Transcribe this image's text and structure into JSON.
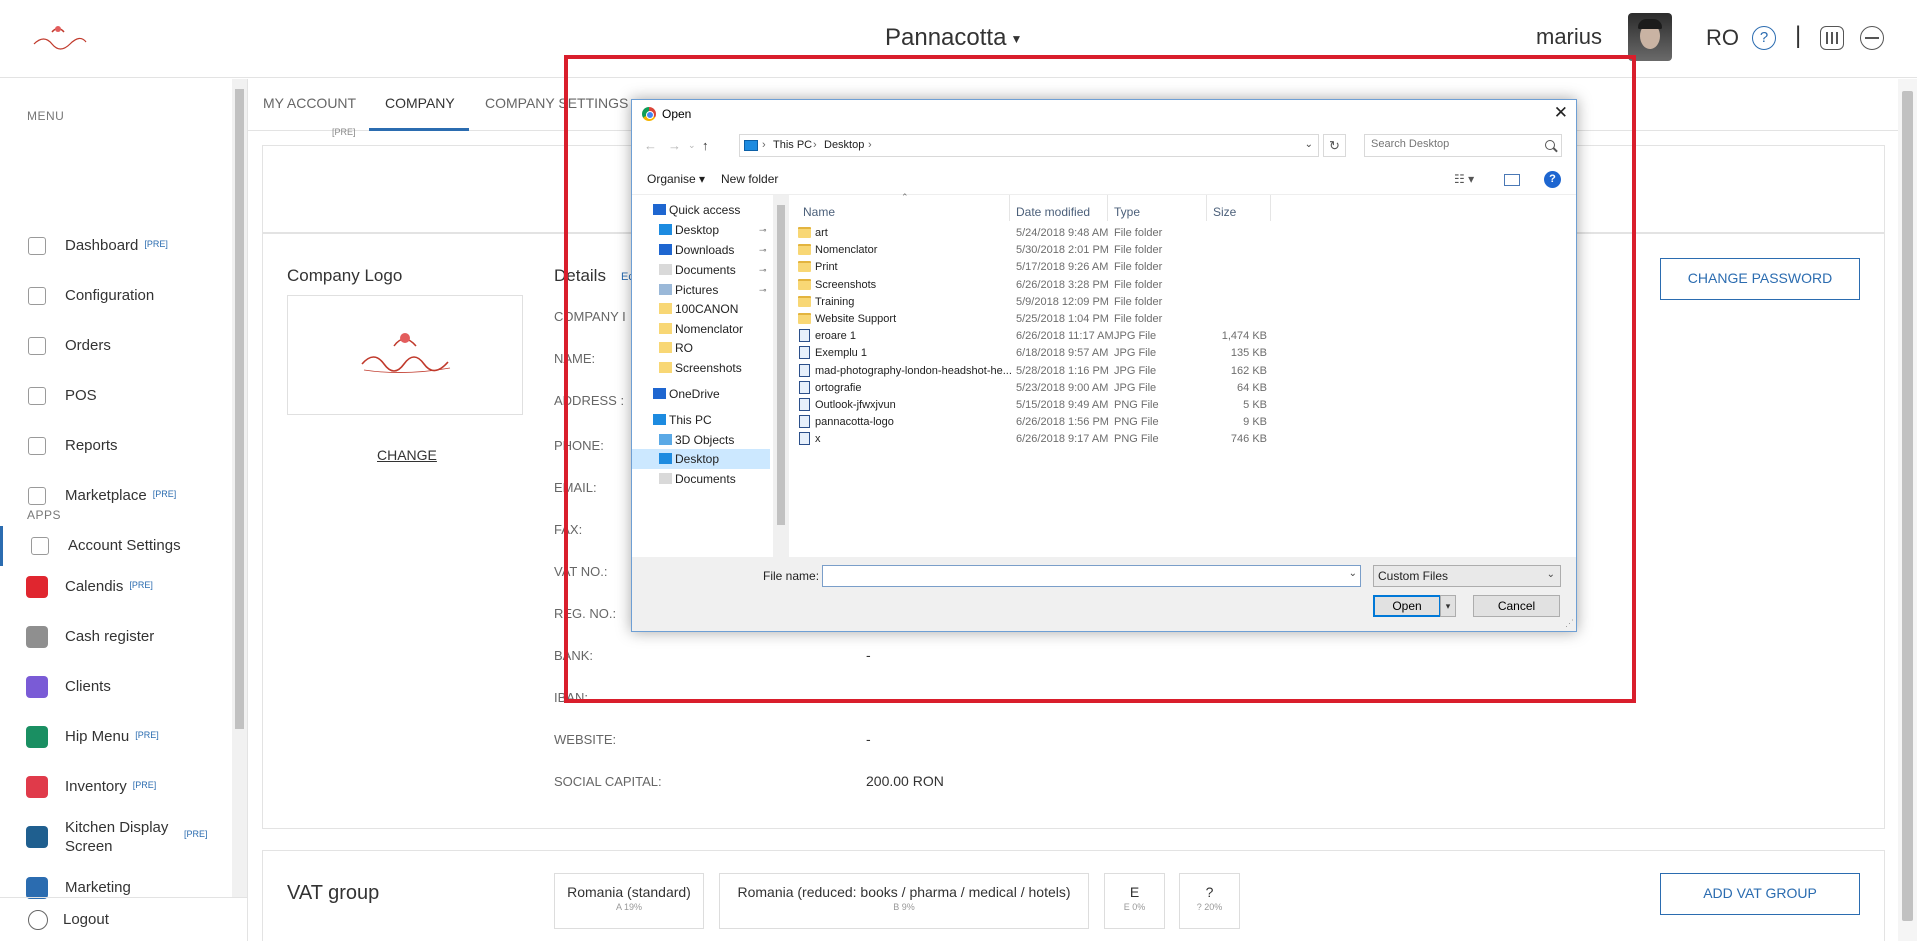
{
  "header": {
    "venue": "Pannacotta",
    "username": "marius",
    "language": "RO",
    "separator": "|"
  },
  "sidebar": {
    "menu_title": "MENU",
    "apps_title": "APPS",
    "pre_tag": "[PRE]",
    "menu_items": [
      {
        "label": "Dashboard",
        "icon": "bar-chart-icon",
        "pre": true
      },
      {
        "label": "Configuration",
        "icon": "tag-icon",
        "pre": false
      },
      {
        "label": "Orders",
        "icon": "lock-icon",
        "pre": false
      },
      {
        "label": "POS",
        "icon": "monitor-icon",
        "pre": false
      },
      {
        "label": "Reports",
        "icon": "line-chart-icon",
        "pre": false
      },
      {
        "label": "Marketplace",
        "icon": "cart-icon",
        "pre": true
      },
      {
        "label": "Account Settings",
        "icon": "gear-icon",
        "pre": false
      }
    ],
    "app_items": [
      {
        "label": "Calendis",
        "pre": true,
        "color": "#e0262f"
      },
      {
        "label": "Cash register",
        "pre": false,
        "color": "#8f8f8f"
      },
      {
        "label": "Clients",
        "pre": false,
        "color": "#7a5bd6"
      },
      {
        "label": "Hip Menu",
        "pre": true,
        "color": "#1a8f62"
      },
      {
        "label": "Inventory",
        "pre": true,
        "color": "#e03a4a"
      },
      {
        "label": "Kitchen Display Screen",
        "pre": true,
        "color": "#1f5f8f"
      },
      {
        "label": "Marketing",
        "pre": false,
        "color": "#2b6cb0"
      }
    ],
    "logout": "Logout"
  },
  "tabs": {
    "items": [
      "MY ACCOUNT",
      "COMPANY",
      "COMPANY SETTINGS"
    ],
    "active": "COMPANY",
    "pre_tag": "[PRE]"
  },
  "company": {
    "logo_title": "Company Logo",
    "change_link": "CHANGE",
    "details_title": "Details",
    "details_edit": "Ec",
    "change_password": "CHANGE PASSWORD",
    "fields": [
      {
        "label": "COMPANY I",
        "value": ""
      },
      {
        "label": "NAME:",
        "value": ""
      },
      {
        "label": "ADDRESS :",
        "value": ""
      },
      {
        "label": "PHONE:",
        "value": ""
      },
      {
        "label": "EMAIL:",
        "value": ""
      },
      {
        "label": "FAX:",
        "value": ""
      },
      {
        "label": "VAT NO.:",
        "value": ""
      },
      {
        "label": "REG. NO.:",
        "value": ""
      },
      {
        "label": "BANK:",
        "value": "-"
      },
      {
        "label": "IBAN:",
        "value": ""
      },
      {
        "label": "WEBSITE:",
        "value": "-"
      },
      {
        "label": "SOCIAL CAPITAL:",
        "value": "200.00 RON"
      }
    ]
  },
  "vat": {
    "title": "VAT group",
    "add_button": "ADD VAT GROUP",
    "groups": [
      {
        "name": "Romania (standard)",
        "sub": "A 19%"
      },
      {
        "name": "Romania (reduced: books / pharma / medical / hotels)",
        "sub": "B 9%"
      },
      {
        "name": "E",
        "sub": "E 0%"
      },
      {
        "name": "?",
        "sub": "? 20%"
      }
    ]
  },
  "dialog": {
    "title": "Open",
    "close": "✕",
    "breadcrumb": [
      "This PC",
      "Desktop"
    ],
    "search_placeholder": "Search Desktop",
    "toolbar": {
      "organise": "Organise ▾",
      "new_folder": "New folder",
      "help": "?"
    },
    "nav_items": [
      {
        "label": "Quick access",
        "icon": "star-icon",
        "pinned": false,
        "indent": 0
      },
      {
        "label": "Desktop",
        "icon": "desktop-icon",
        "pinned": true,
        "indent": 1
      },
      {
        "label": "Downloads",
        "icon": "download-icon",
        "pinned": true,
        "indent": 1
      },
      {
        "label": "Documents",
        "icon": "document-icon",
        "pinned": true,
        "indent": 1
      },
      {
        "label": "Pictures",
        "icon": "picture-icon",
        "pinned": true,
        "indent": 1
      },
      {
        "label": "100CANON",
        "icon": "folder-icon",
        "pinned": false,
        "indent": 1
      },
      {
        "label": "Nomenclator",
        "icon": "folder-icon",
        "pinned": false,
        "indent": 1
      },
      {
        "label": "RO",
        "icon": "folder-icon",
        "pinned": false,
        "indent": 1
      },
      {
        "label": "Screenshots",
        "icon": "folder-icon",
        "pinned": false,
        "indent": 1
      },
      {
        "label": "OneDrive",
        "icon": "cloud-icon",
        "pinned": false,
        "indent": 0
      },
      {
        "label": "This PC",
        "icon": "pc-icon",
        "pinned": false,
        "indent": 0
      },
      {
        "label": "3D Objects",
        "icon": "cube-icon",
        "pinned": false,
        "indent": 1
      },
      {
        "label": "Desktop",
        "icon": "desktop-icon",
        "pinned": false,
        "indent": 1
      },
      {
        "label": "Documents",
        "icon": "document-icon",
        "pinned": false,
        "indent": 1
      }
    ],
    "nav_selected_index": 12,
    "columns": [
      "Name",
      "Date modified",
      "Type",
      "Size"
    ],
    "files": [
      {
        "name": "art",
        "date": "5/24/2018 9:48 AM",
        "type": "File folder",
        "size": "",
        "kind": "folder"
      },
      {
        "name": "Nomenclator",
        "date": "5/30/2018 2:01 PM",
        "type": "File folder",
        "size": "",
        "kind": "folder"
      },
      {
        "name": "Print",
        "date": "5/17/2018 9:26 AM",
        "type": "File folder",
        "size": "",
        "kind": "folder"
      },
      {
        "name": "Screenshots",
        "date": "6/26/2018 3:28 PM",
        "type": "File folder",
        "size": "",
        "kind": "folder"
      },
      {
        "name": "Training",
        "date": "5/9/2018 12:09 PM",
        "type": "File folder",
        "size": "",
        "kind": "folder"
      },
      {
        "name": "Website Support",
        "date": "5/25/2018 1:04 PM",
        "type": "File folder",
        "size": "",
        "kind": "folder"
      },
      {
        "name": "eroare 1",
        "date": "6/26/2018 11:17 AM",
        "type": "JPG File",
        "size": "1,474 KB",
        "kind": "file"
      },
      {
        "name": "Exemplu 1",
        "date": "6/18/2018 9:57 AM",
        "type": "JPG File",
        "size": "135 KB",
        "kind": "file"
      },
      {
        "name": "mad-photography-london-headshot-he...",
        "date": "5/28/2018 1:16 PM",
        "type": "JPG File",
        "size": "162 KB",
        "kind": "file"
      },
      {
        "name": "ortografie",
        "date": "5/23/2018 9:00 AM",
        "type": "JPG File",
        "size": "64 KB",
        "kind": "file"
      },
      {
        "name": "Outlook-jfwxjvun",
        "date": "5/15/2018 9:49 AM",
        "type": "PNG File",
        "size": "5 KB",
        "kind": "file"
      },
      {
        "name": "pannacotta-logo",
        "date": "6/26/2018 1:56 PM",
        "type": "PNG File",
        "size": "9 KB",
        "kind": "file"
      },
      {
        "name": "x",
        "date": "6/26/2018 9:17 AM",
        "type": "PNG File",
        "size": "746 KB",
        "kind": "file"
      }
    ],
    "file_name_label": "File name:",
    "file_name_value": "",
    "file_type": "Custom Files",
    "open_button": "Open",
    "cancel_button": "Cancel"
  },
  "colors": {
    "accent": "#2b6cb0",
    "highlight": "#d91e2c"
  }
}
